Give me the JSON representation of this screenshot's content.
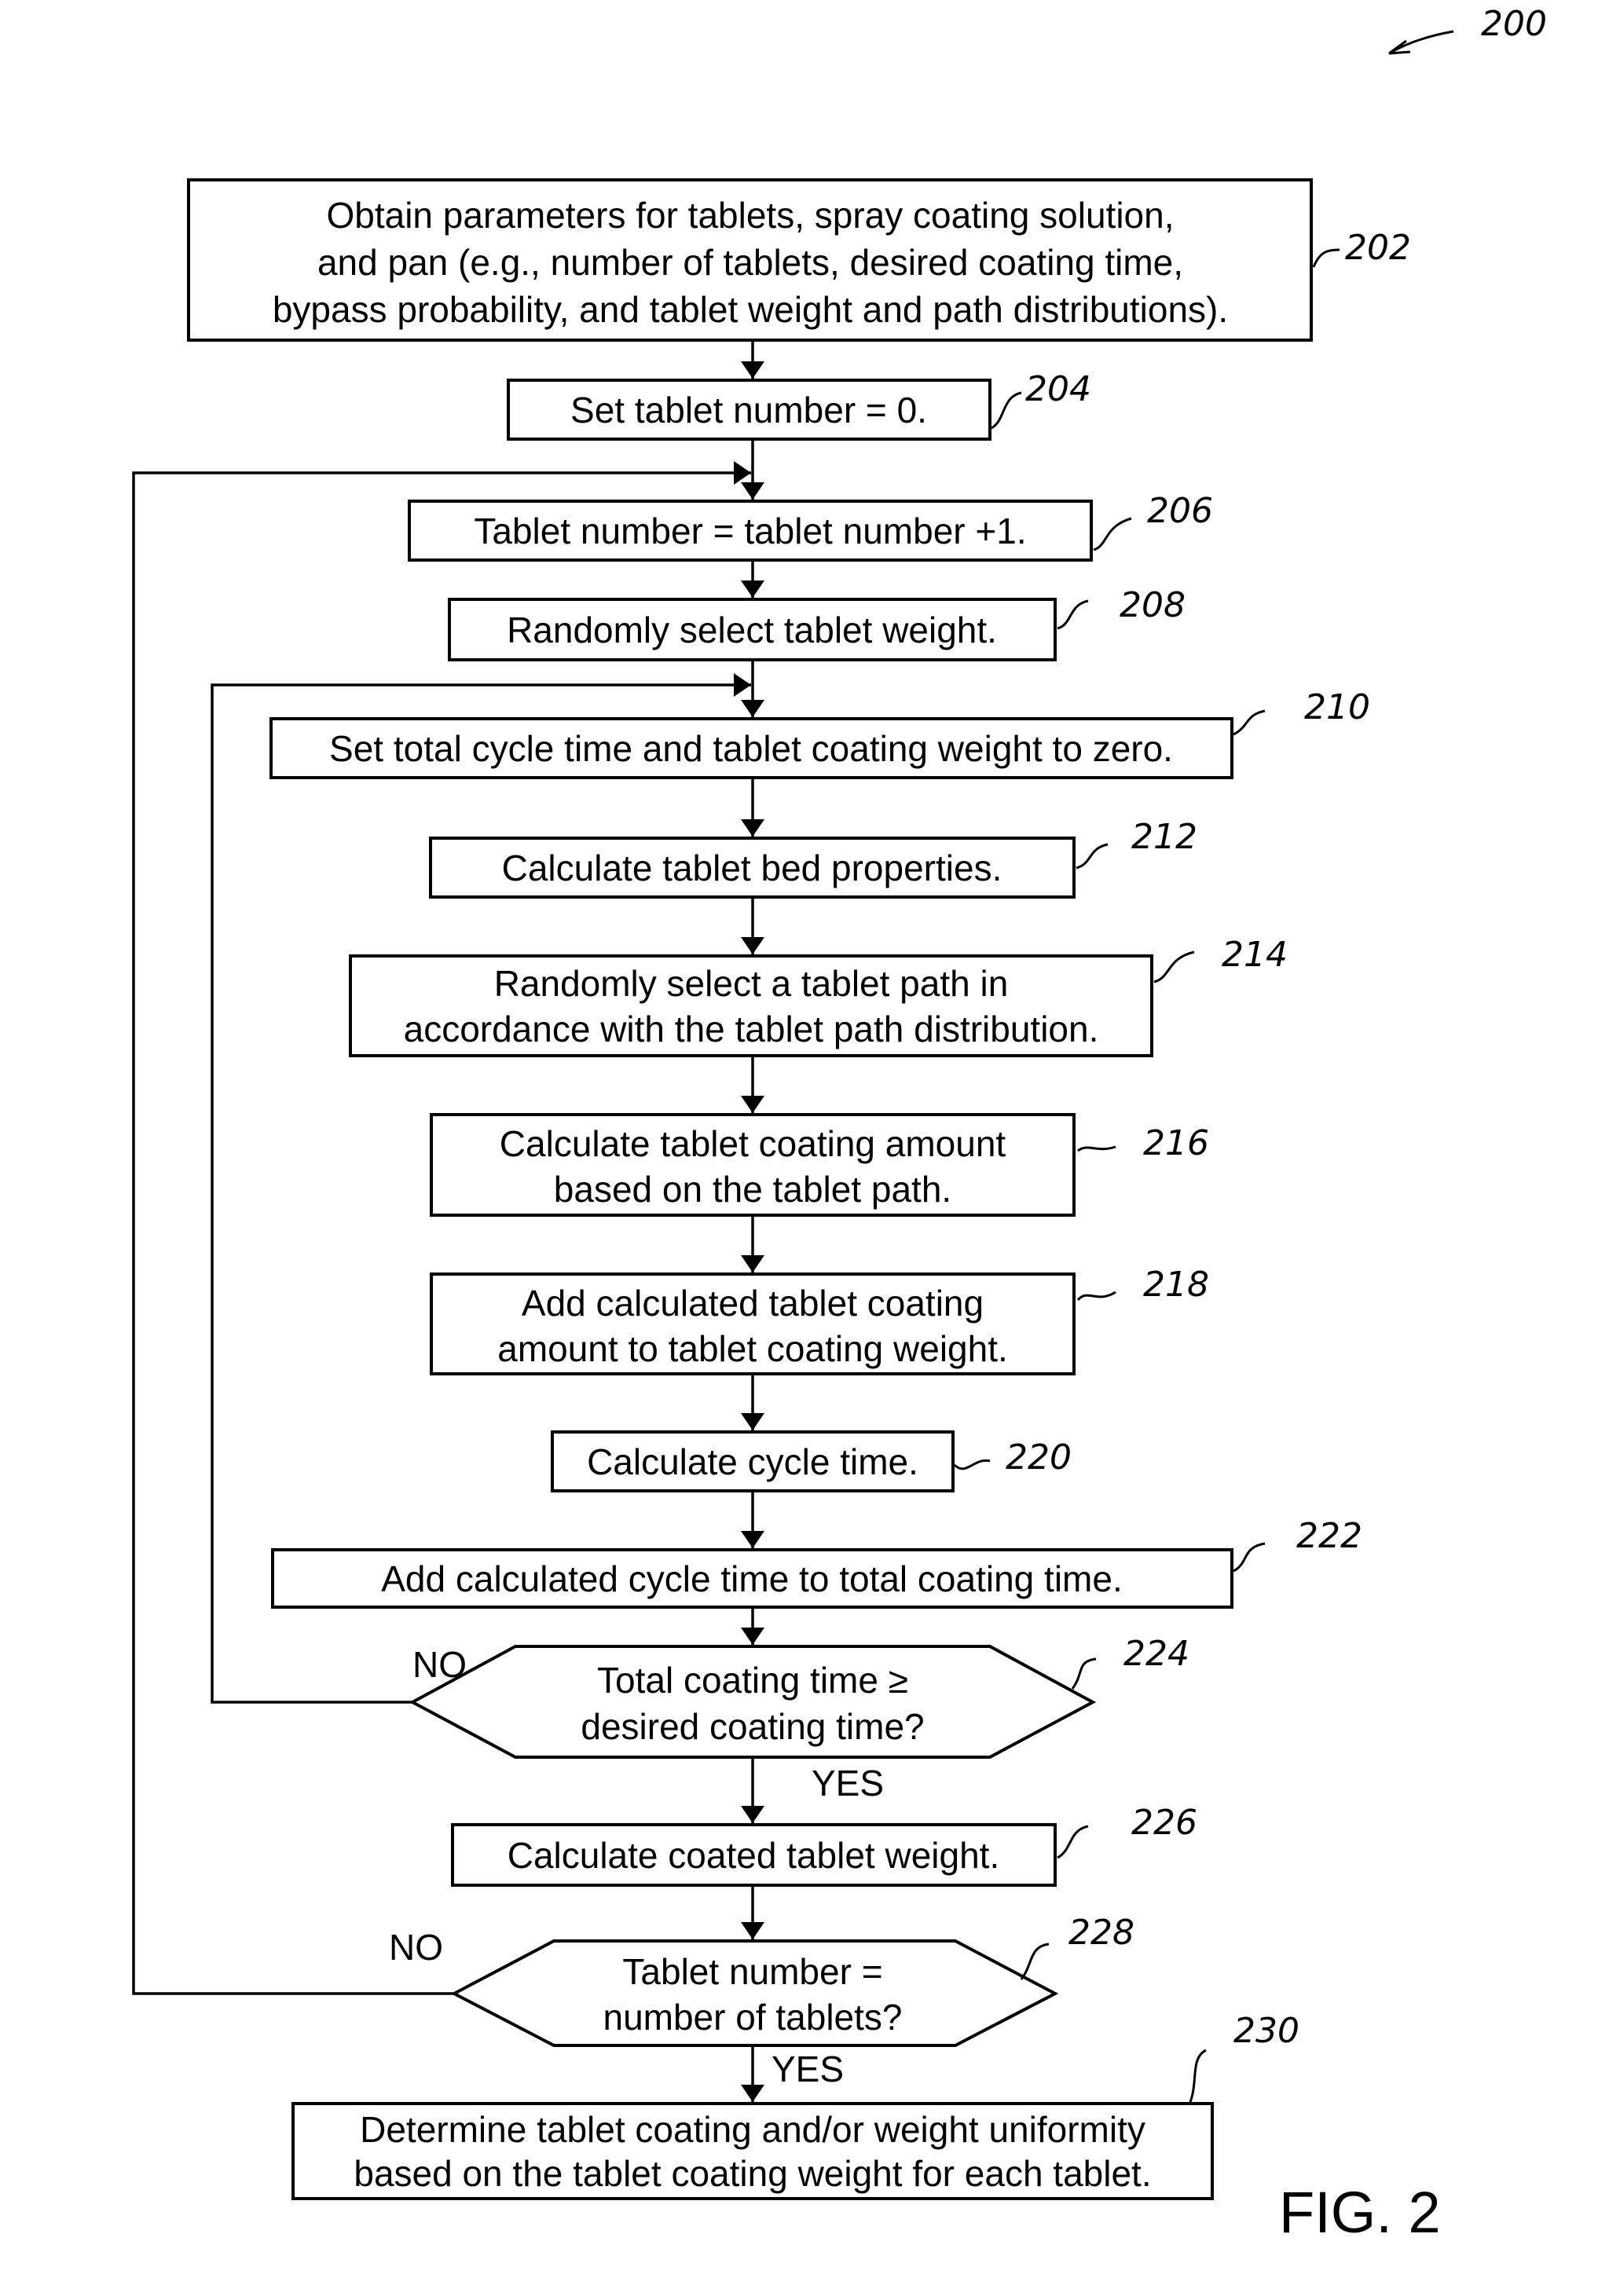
{
  "figure": {
    "reference": "200",
    "caption": "FIG. 2"
  },
  "steps": [
    {
      "id": "202",
      "lines": [
        "Obtain parameters for tablets, spray coating solution,",
        "and pan (e.g., number of tablets, desired coating time,",
        "bypass probability, and tablet weight and path distributions)."
      ]
    },
    {
      "id": "204",
      "lines": [
        "Set tablet number = 0."
      ]
    },
    {
      "id": "206",
      "lines": [
        "Tablet number = tablet number +1."
      ]
    },
    {
      "id": "208",
      "lines": [
        "Randomly select tablet weight."
      ]
    },
    {
      "id": "210",
      "lines": [
        "Set total cycle time and tablet coating weight to zero."
      ]
    },
    {
      "id": "212",
      "lines": [
        "Calculate tablet bed properties."
      ]
    },
    {
      "id": "214",
      "lines": [
        "Randomly select a tablet path in",
        "accordance with the tablet path distribution."
      ]
    },
    {
      "id": "216",
      "lines": [
        "Calculate tablet coating amount",
        "based on the tablet path."
      ]
    },
    {
      "id": "218",
      "lines": [
        "Add calculated tablet coating",
        "amount to tablet coating weight."
      ]
    },
    {
      "id": "220",
      "lines": [
        "Calculate cycle time."
      ]
    },
    {
      "id": "222",
      "lines": [
        "Add calculated cycle time to total coating time."
      ]
    },
    {
      "id": "224",
      "lines": [
        "Total coating time ≥",
        "desired coating time?"
      ],
      "no_label": "NO",
      "yes_label": "YES"
    },
    {
      "id": "226",
      "lines": [
        "Calculate coated tablet weight."
      ]
    },
    {
      "id": "228",
      "lines": [
        "Tablet number =",
        "number of tablets?"
      ],
      "no_label": "NO",
      "yes_label": "YES"
    },
    {
      "id": "230",
      "lines": [
        "Determine tablet coating and/or weight uniformity",
        "based on the tablet coating weight for each tablet."
      ]
    }
  ]
}
